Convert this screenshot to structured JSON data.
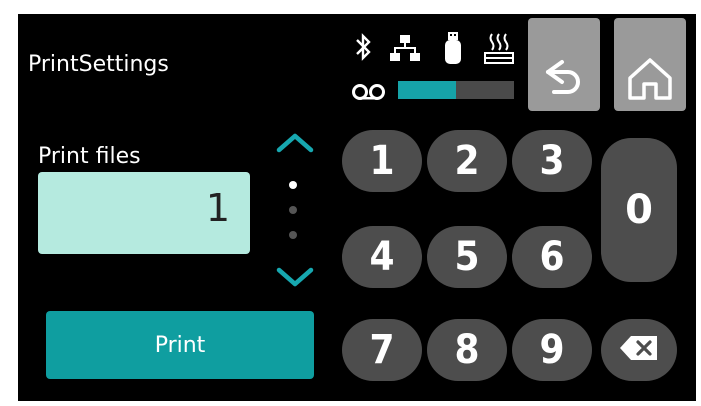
{
  "header": {
    "title": "PrintSettings",
    "status_icons": [
      "bluetooth-icon",
      "network-icon",
      "usb-drive-icon",
      "heater-icon"
    ],
    "signal_icon": "tape-icon",
    "progress_fraction": 0.5,
    "accent_color": "#16a3a8"
  },
  "nav": {
    "back_icon": "back-arrow-icon",
    "home_icon": "home-icon"
  },
  "form": {
    "label": "Print files",
    "value": "1",
    "field_color": "#b5eadf",
    "page_indicator": {
      "total": 3,
      "active": 1
    }
  },
  "actions": {
    "print_label": "Print"
  },
  "keypad": {
    "keys": [
      "1",
      "2",
      "3",
      "4",
      "5",
      "6",
      "7",
      "8",
      "9"
    ],
    "zero": "0",
    "backspace_icon": "backspace-icon"
  }
}
